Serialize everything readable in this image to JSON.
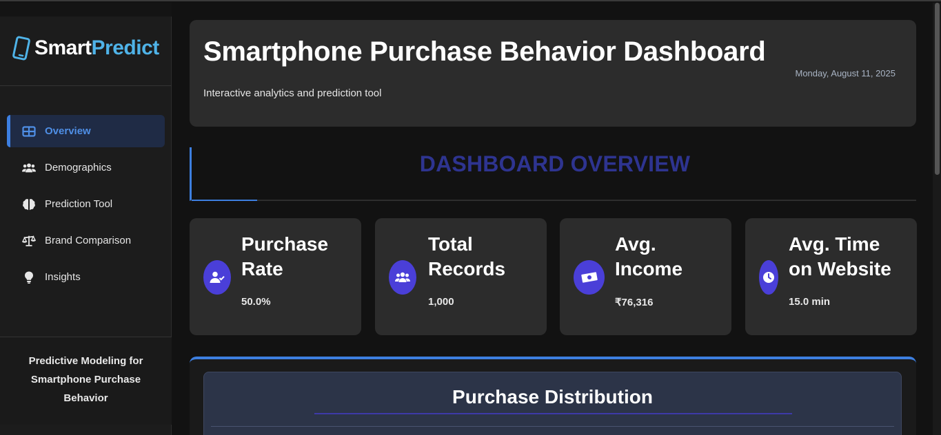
{
  "brand": {
    "word1": "Smart",
    "word2": "Predict",
    "accent": "#4fb3e8",
    "icon": "mobile-phone-icon"
  },
  "nav": {
    "items": [
      {
        "label": "Overview",
        "icon": "grid-icon",
        "active": true
      },
      {
        "label": "Demographics",
        "icon": "users-icon",
        "active": false
      },
      {
        "label": "Prediction Tool",
        "icon": "brain-icon",
        "active": false
      },
      {
        "label": "Brand Comparison",
        "icon": "scale-icon",
        "active": false
      },
      {
        "label": "Insights",
        "icon": "lightbulb-icon",
        "active": false
      }
    ]
  },
  "sidebar_footer": {
    "line1": "Predictive Modeling for",
    "line2": "Smartphone Purchase",
    "line3": "Behavior"
  },
  "header": {
    "title": "Smartphone Purchase Behavior Dashboard",
    "subtitle": "Interactive analytics and prediction tool",
    "date": "Monday, August 11, 2025"
  },
  "section": {
    "title": "DASHBOARD OVERVIEW"
  },
  "stats": [
    {
      "label": "Purchase\nRate",
      "value": "50.0%",
      "icon": "user-check-icon"
    },
    {
      "label": "Total\nRecords",
      "value": "1,000",
      "icon": "users-icon"
    },
    {
      "label": "Avg.\nIncome",
      "value": "₹76,316",
      "icon": "money-bill-icon"
    },
    {
      "label": "Avg. Time\non Website",
      "value": "15.0 min",
      "icon": "clock-icon"
    }
  ],
  "chart": {
    "title": "Purchase Distribution"
  },
  "colors": {
    "accent_blue": "#3d7fe0",
    "stat_icon_bg": "#4a3fd8",
    "section_title": "#2e3490"
  }
}
